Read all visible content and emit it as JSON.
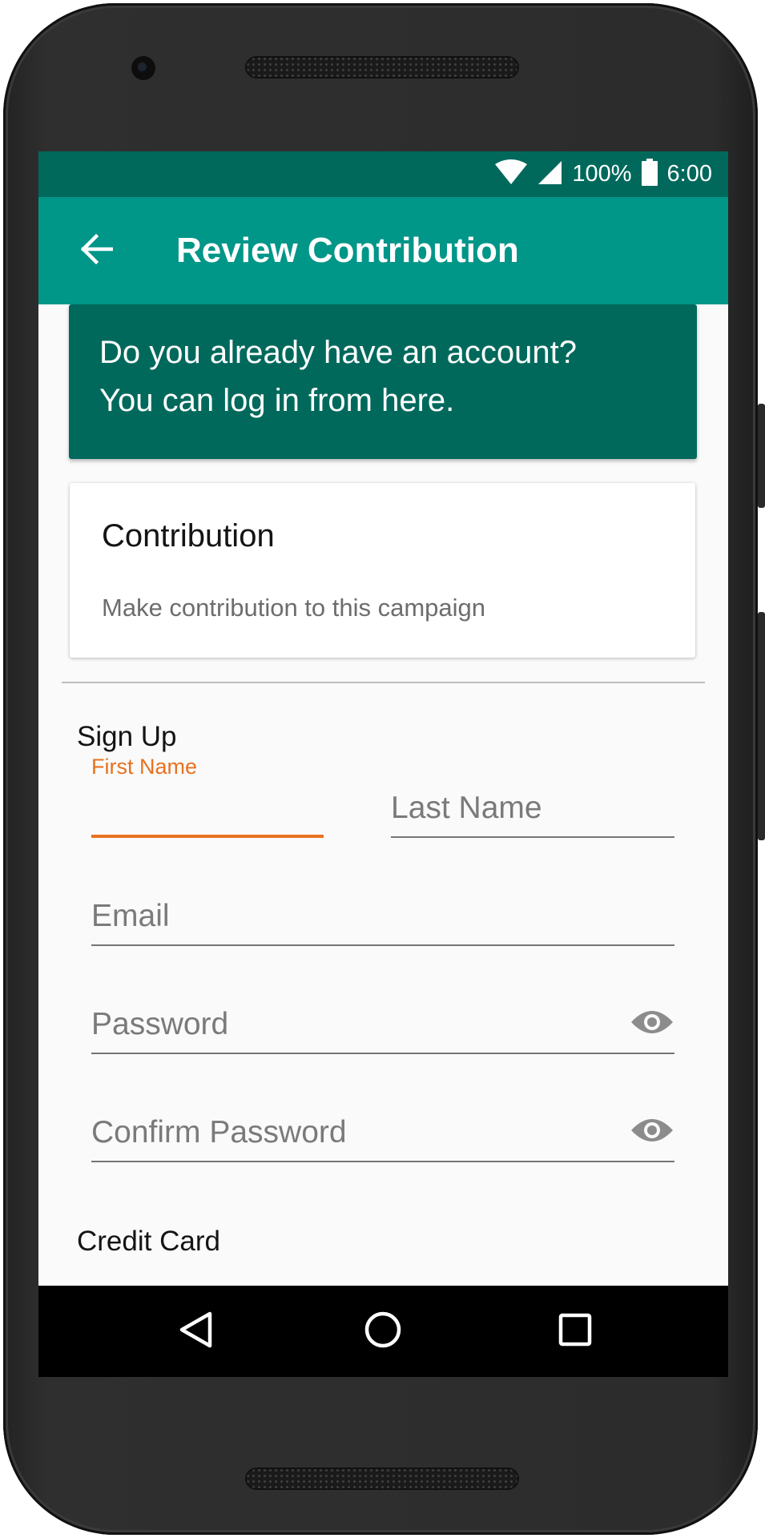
{
  "status_bar": {
    "battery_percent": "100%",
    "time": "6:00"
  },
  "app_bar": {
    "title": "Review Contribution"
  },
  "account_banner": {
    "line1": "Do you already have an account?",
    "line2": "You can log in from here."
  },
  "contribution_card": {
    "title": "Contribution",
    "subtitle": "Make contribution to this campaign"
  },
  "sign_up": {
    "section_label": "Sign Up",
    "first_name": {
      "label": "First Name",
      "value": ""
    },
    "last_name": {
      "placeholder": "Last Name",
      "value": ""
    },
    "email": {
      "placeholder": "Email",
      "value": ""
    },
    "password": {
      "placeholder": "Password",
      "value": ""
    },
    "confirm_password": {
      "placeholder": "Confirm Password",
      "value": ""
    }
  },
  "credit_card": {
    "section_label": "Credit Card"
  },
  "colors": {
    "primary": "#009688",
    "primary_dark": "#00695c",
    "accent": "#e8711f"
  },
  "icons": {
    "back": "arrow-back-icon",
    "wifi": "wifi-icon",
    "signal": "cell-signal-icon",
    "battery": "battery-icon",
    "visibility": "eye-icon",
    "nav_back": "triangle-back-icon",
    "nav_home": "circle-home-icon",
    "nav_recents": "square-recents-icon"
  }
}
